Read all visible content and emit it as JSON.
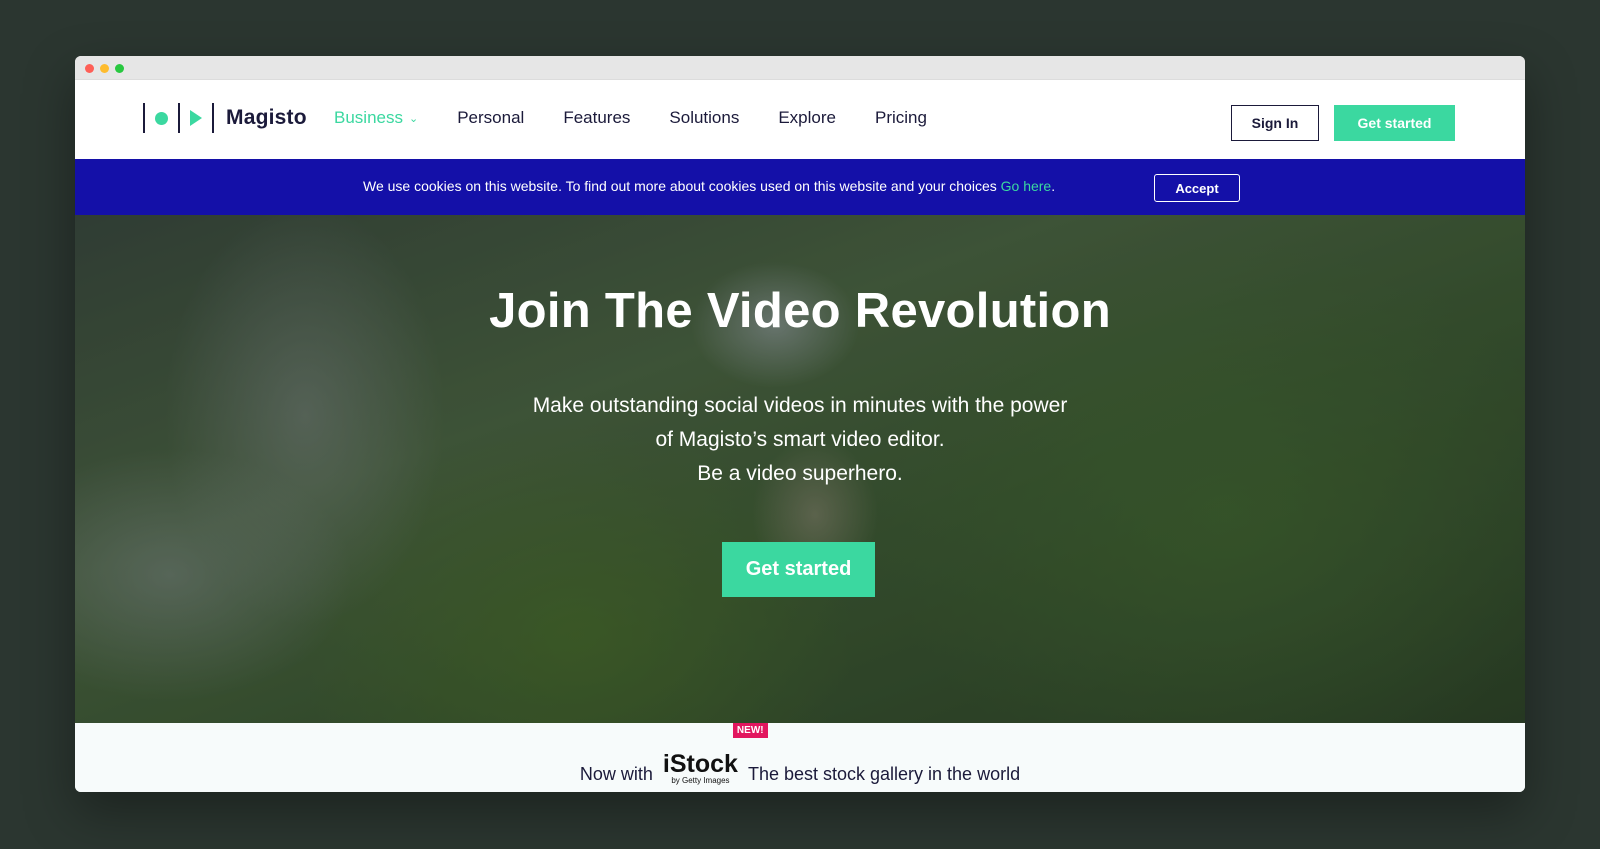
{
  "navbar": {
    "logo_text": "Magisto",
    "links": [
      "Business",
      "Personal",
      "Features",
      "Solutions",
      "Explore",
      "Pricing"
    ],
    "sign_in": "Sign In",
    "get_started": "Get started"
  },
  "cookie": {
    "message": "We use cookies on this website. To find out more about cookies used on this website and your choices ",
    "link": "Go here",
    "period": ".",
    "accept": "Accept"
  },
  "hero": {
    "title": "Join The Video Revolution",
    "sub_line1": "Make outstanding social videos in minutes with the power",
    "sub_line2": "of Magisto’s smart video editor.",
    "sub_line3": "Be a video superhero.",
    "cta": "Get started"
  },
  "footer_strip": {
    "prefix": "Now with",
    "brand": "iStock",
    "brand_sub": "by Getty Images",
    "badge": "NEW!",
    "suffix": "The best stock gallery in the world"
  },
  "colors": {
    "accent": "#3bd8a0",
    "cookie_bar": "#1410a8",
    "text_dark": "#1b1a3a",
    "badge": "#e2165e"
  }
}
